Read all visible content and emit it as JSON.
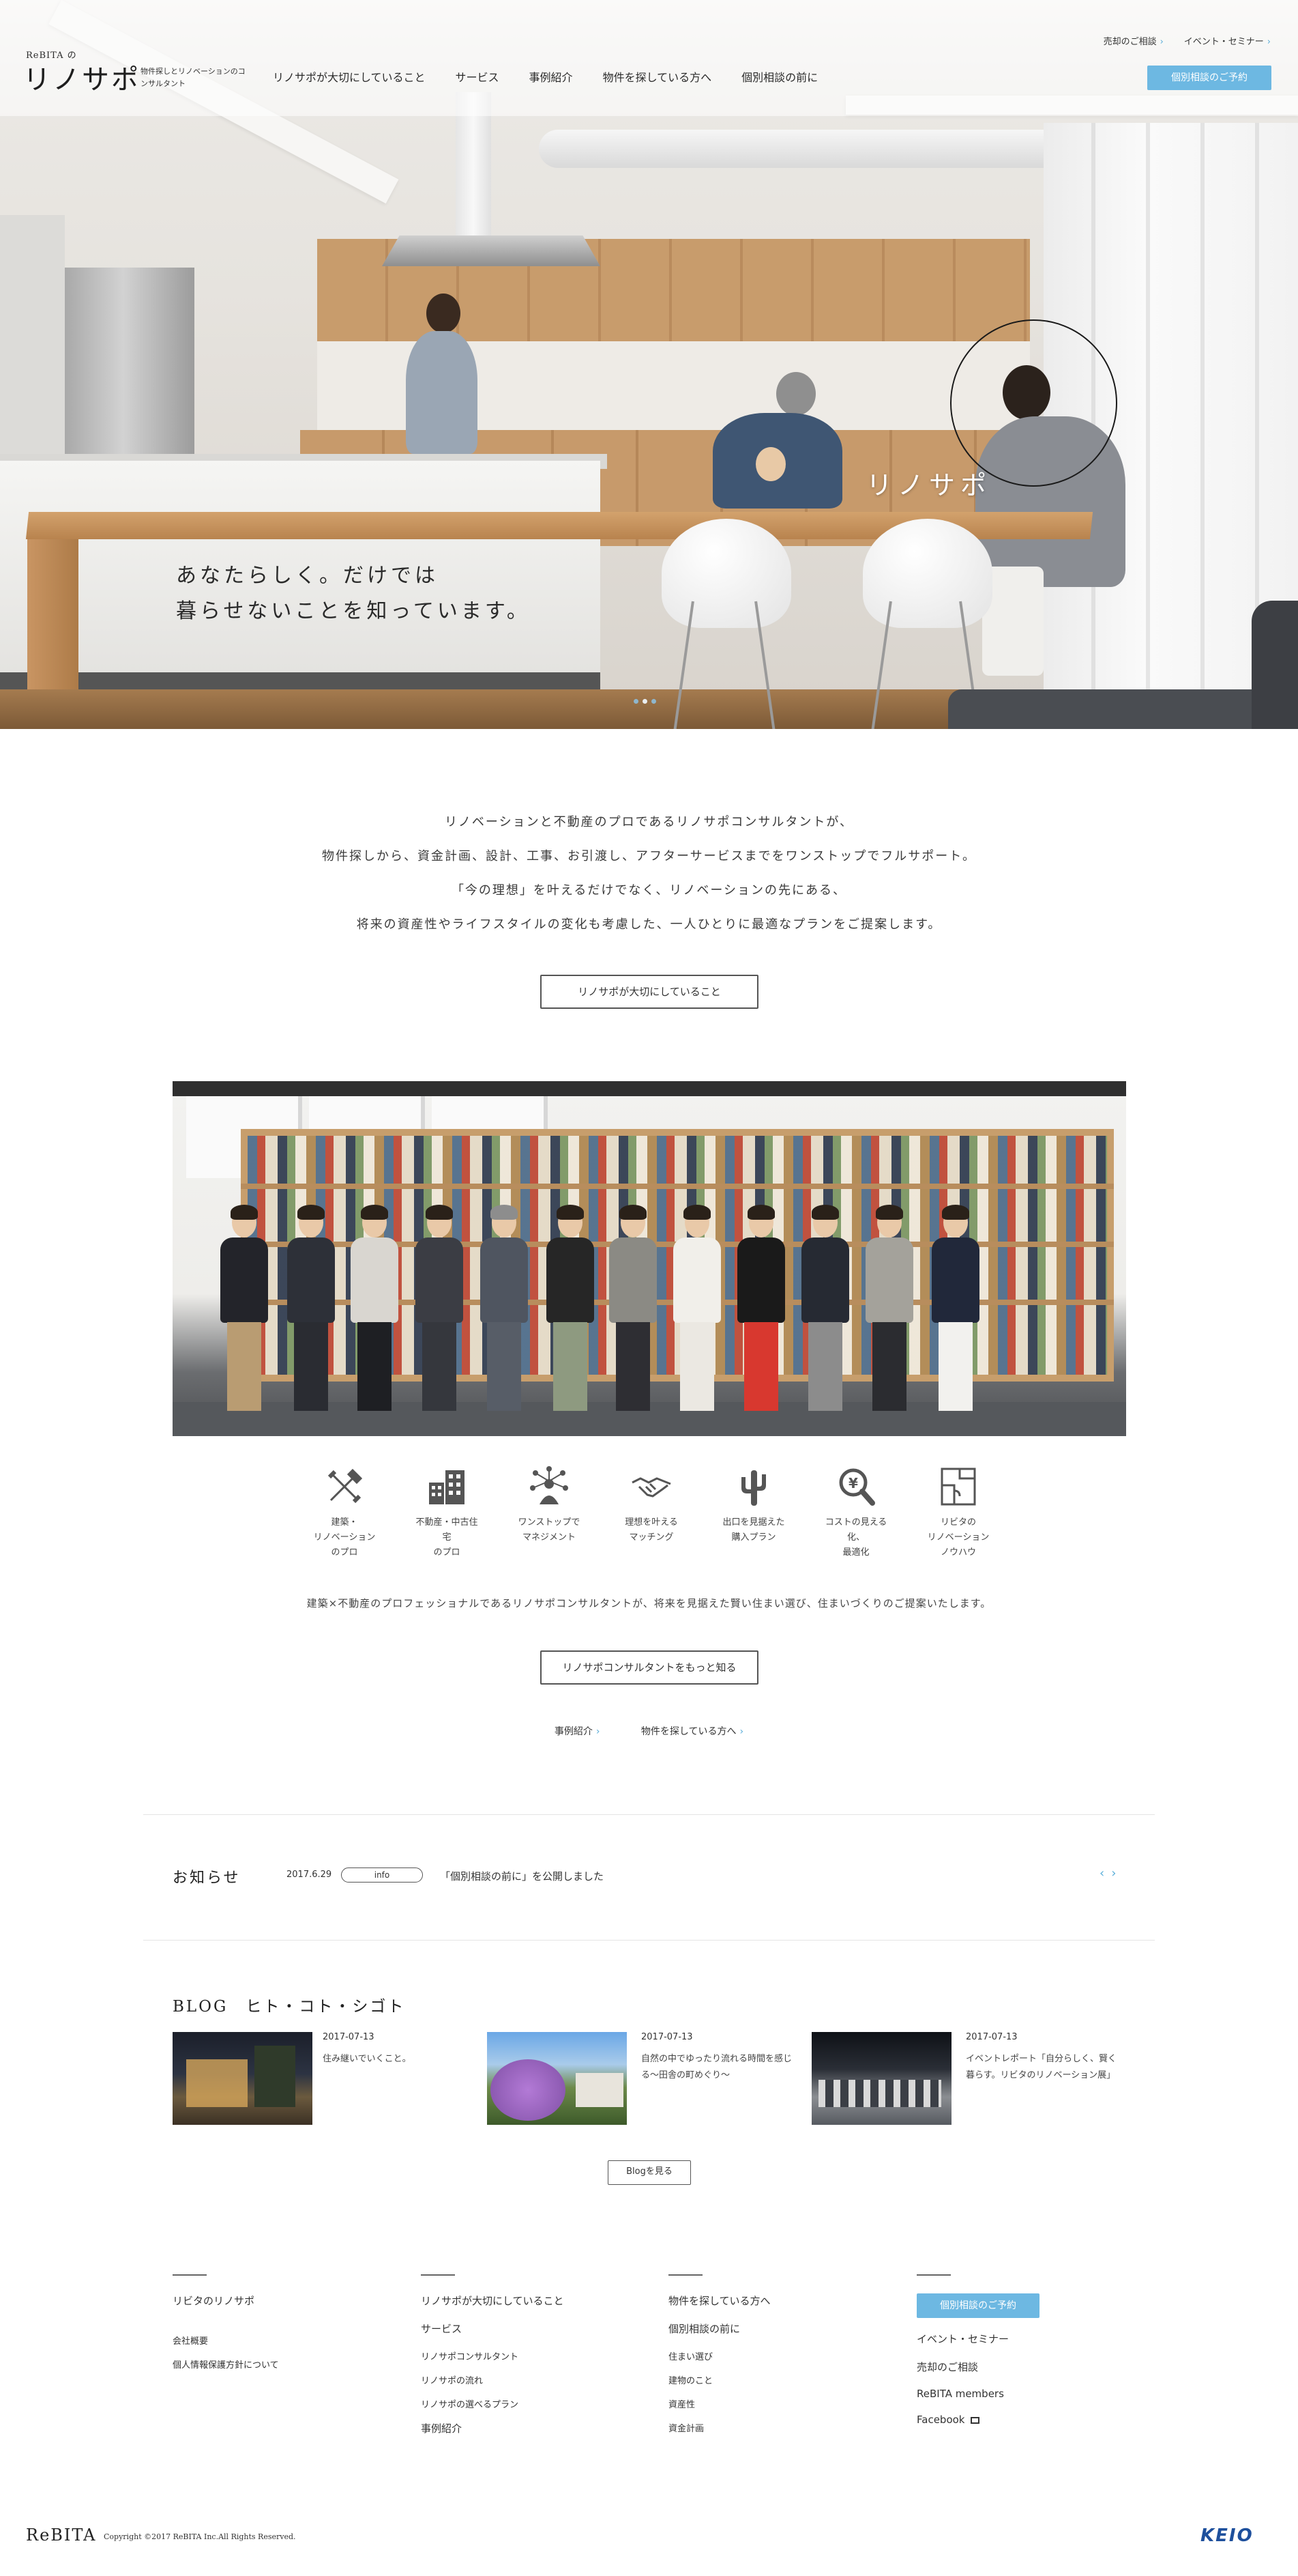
{
  "header": {
    "logo_small": "ReBITA の",
    "logo_main": "リノサポ",
    "logo_tagline": "物件探しとリノベーションのコンサルタント",
    "nav": [
      {
        "label": "リノサポが大切にしていること"
      },
      {
        "label": "サービス"
      },
      {
        "label": "事例紹介"
      },
      {
        "label": "物件を探している方へ"
      },
      {
        "label": "個別相談の前に"
      }
    ],
    "util_links": [
      {
        "label": "売却のご相談"
      },
      {
        "label": "イベント・セミナー"
      }
    ],
    "consult_button": "個別相談のご予約",
    "accent_color": "#6db8e2"
  },
  "hero": {
    "brand_overlay": "リノサポ",
    "copy": "あなたらしく。だけでは\n暮らせないことを知っています。",
    "slides": 3,
    "active_slide": 2
  },
  "intro": {
    "lines": [
      "リノベーションと不動産のプロであるリノサポコンサルタントが、",
      "物件探しから、資金計画、設計、工事、お引渡し、アフターサービスまでをワンストップでフルサポート。",
      "「今の理想」を叶えるだけでなく、リノベーションの先にある、",
      "将来の資産性やライフスタイルの変化も考慮した、一人ひとりに最適なプランをご提案します。"
    ],
    "button": "リノサポが大切にしていること"
  },
  "features": {
    "items": [
      {
        "icon": "tools-icon",
        "label": "建築・\nリノベーション\nのプロ"
      },
      {
        "icon": "building-icon",
        "label": "不動産・中古住宅\nのプロ"
      },
      {
        "icon": "network-icon",
        "label": "ワンストップで\nマネジメント"
      },
      {
        "icon": "handshake-icon",
        "label": "理想を叶える\nマッチング"
      },
      {
        "icon": "cactus-icon",
        "label": "出口を見据えた\n購入プラン"
      },
      {
        "icon": "yen-search-icon",
        "label": "コストの見える化、\n最適化"
      },
      {
        "icon": "floorplan-icon",
        "label": "リビタの\nリノベーション\nノウハウ"
      }
    ],
    "description": "建築×不動産のプロフェッショナルであるリノサポコンサルタントが、将来を見据えた賢い住まい選び、住まいづくりのご提案いたします。",
    "button": "リノサポコンサルタントをもっと知る",
    "links": [
      {
        "label": "事例紹介"
      },
      {
        "label": "物件を探している方へ"
      }
    ]
  },
  "news": {
    "title": "お知らせ",
    "date": "2017.6.29",
    "tag": "info",
    "text": "「個別相談の前に」を公開しました",
    "prev": "‹",
    "next": "›"
  },
  "blog": {
    "title": "BLOG　ヒト・コト・シゴト",
    "posts": [
      {
        "date": "2017-07-13",
        "text": "住み継いでいくこと。"
      },
      {
        "date": "2017-07-13",
        "text": "自然の中でゆったり流れる時間を感じる〜田舎の町めぐり〜"
      },
      {
        "date": "2017-07-13",
        "text": "イベントレポート「自分らしく、賢く暮らす。リビタのリノベーション展」"
      }
    ],
    "button": "Blogを見る"
  },
  "footer": {
    "col1": {
      "main": "リビタのリノサポ",
      "items": [
        "会社概要",
        "個人情報保護方針について"
      ]
    },
    "col2": {
      "main": [
        "リノサポが大切にしていること",
        "サービス"
      ],
      "sub": [
        "リノサポコンサルタント",
        "リノサポの流れ",
        "リノサポの選べるプラン"
      ],
      "last": "事例紹介"
    },
    "col3": {
      "main": [
        "物件を探している方へ",
        "個別相談の前に"
      ],
      "sub": [
        "住まい選び",
        "建物のこと",
        "資産性",
        "資金計画"
      ]
    },
    "col4": {
      "button": "個別相談のご予約",
      "items": [
        "イベント・セミナー",
        "売却のご相談",
        "ReBITA members",
        "Facebook"
      ]
    },
    "logo": "ReBITA",
    "copyright": "Copyright ©2017 ReBITA Inc.All Rights Reserved.",
    "partner_logo": "KEIO"
  }
}
